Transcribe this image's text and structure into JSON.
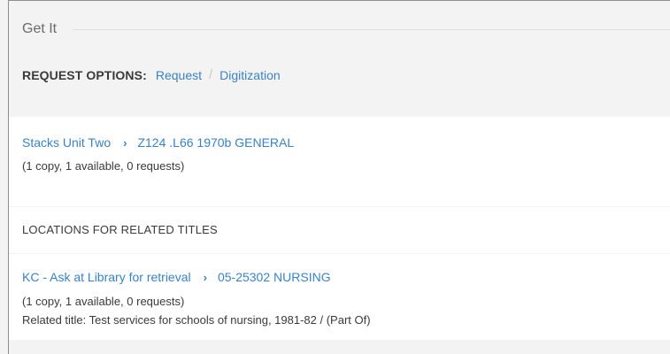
{
  "get_it": {
    "title": "Get It"
  },
  "request_options": {
    "label": "REQUEST OPTIONS:",
    "links": [
      "Request",
      "Digitization"
    ],
    "separator": "/"
  },
  "holding": {
    "location": "Stacks Unit Two",
    "call_number": "Z124 .L66 1970b GENERAL",
    "availability": "(1 copy, 1 available, 0 requests)"
  },
  "related": {
    "header": "LOCATIONS FOR RELATED TITLES",
    "location": "KC - Ask at Library for retrieval",
    "call_number": "05-25302 NURSING",
    "availability": "(1 copy, 1 available, 0 requests)",
    "related_title": "Related title: Test services for schools of nursing, 1981-82 / (Part Of)"
  },
  "icons": {
    "chevron": "chevron-right-icon"
  },
  "colors": {
    "link": "#3b82c4",
    "background": "#f3f3f3",
    "card": "#ffffff"
  }
}
